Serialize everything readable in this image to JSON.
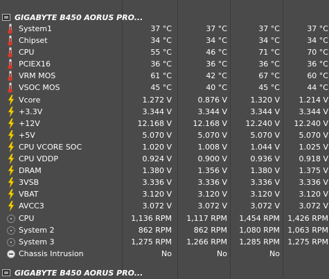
{
  "section_top": {
    "title": "GIGABYTE B450 AORUS PRO..."
  },
  "section_bottom": {
    "title": "GIGABYTE B450 AORUS PRO..."
  },
  "rows": [
    {
      "icon": "thermometer-icon",
      "name": "System1",
      "values": [
        "37 °C",
        "37 °C",
        "37 °C",
        "37 °C"
      ]
    },
    {
      "icon": "thermometer-icon",
      "name": "Chipset",
      "values": [
        "34 °C",
        "34 °C",
        "34 °C",
        "34 °C"
      ]
    },
    {
      "icon": "thermometer-icon",
      "name": "CPU",
      "values": [
        "55 °C",
        "46 °C",
        "71 °C",
        "70 °C"
      ]
    },
    {
      "icon": "thermometer-icon",
      "name": "PCIEX16",
      "values": [
        "36 °C",
        "36 °C",
        "36 °C",
        "36 °C"
      ]
    },
    {
      "icon": "thermometer-icon",
      "name": "VRM MOS",
      "values": [
        "61 °C",
        "42 °C",
        "67 °C",
        "60 °C"
      ]
    },
    {
      "icon": "thermometer-icon",
      "name": "VSOC MOS",
      "values": [
        "45 °C",
        "40 °C",
        "45 °C",
        "44 °C"
      ]
    },
    {
      "icon": "lightning-icon",
      "name": "Vcore",
      "values": [
        "1.272 V",
        "0.876 V",
        "1.320 V",
        "1.214 V"
      ]
    },
    {
      "icon": "lightning-icon",
      "name": "+3.3V",
      "values": [
        "3.344 V",
        "3.344 V",
        "3.344 V",
        "3.344 V"
      ]
    },
    {
      "icon": "lightning-icon",
      "name": "+12V",
      "values": [
        "12.168 V",
        "12.168 V",
        "12.240 V",
        "12.240 V"
      ]
    },
    {
      "icon": "lightning-icon",
      "name": "+5V",
      "values": [
        "5.070 V",
        "5.070 V",
        "5.070 V",
        "5.070 V"
      ]
    },
    {
      "icon": "lightning-icon",
      "name": "CPU VCORE SOC",
      "values": [
        "1.020 V",
        "1.008 V",
        "1.044 V",
        "1.025 V"
      ]
    },
    {
      "icon": "lightning-icon",
      "name": "CPU VDDP",
      "values": [
        "0.924 V",
        "0.900 V",
        "0.936 V",
        "0.918 V"
      ]
    },
    {
      "icon": "lightning-icon",
      "name": "DRAM",
      "values": [
        "1.380 V",
        "1.356 V",
        "1.380 V",
        "1.375 V"
      ]
    },
    {
      "icon": "lightning-icon",
      "name": "3VSB",
      "values": [
        "3.336 V",
        "3.336 V",
        "3.336 V",
        "3.336 V"
      ]
    },
    {
      "icon": "lightning-icon",
      "name": "VBAT",
      "values": [
        "3.120 V",
        "3.120 V",
        "3.120 V",
        "3.120 V"
      ]
    },
    {
      "icon": "lightning-icon",
      "name": "AVCC3",
      "values": [
        "3.072 V",
        "3.072 V",
        "3.072 V",
        "3.072 V"
      ]
    },
    {
      "icon": "fan-icon",
      "name": "CPU",
      "values": [
        "1,136 RPM",
        "1,117 RPM",
        "1,454 RPM",
        "1,426 RPM"
      ]
    },
    {
      "icon": "fan-icon",
      "name": "System 2",
      "values": [
        "862 RPM",
        "862 RPM",
        "1,080 RPM",
        "1,063 RPM"
      ]
    },
    {
      "icon": "fan-icon",
      "name": "System 3",
      "values": [
        "1,275 RPM",
        "1,266 RPM",
        "1,285 RPM",
        "1,275 RPM"
      ]
    },
    {
      "icon": "chassis-icon",
      "name": "Chassis Intrusion",
      "values": [
        "No",
        "No",
        "No",
        ""
      ]
    }
  ],
  "colors": {
    "background": "#4a4a4a",
    "grid": "#3a3a3a",
    "text": "#ffffff",
    "bolt": "#f5d000",
    "thermo_red": "#d23a2a"
  }
}
